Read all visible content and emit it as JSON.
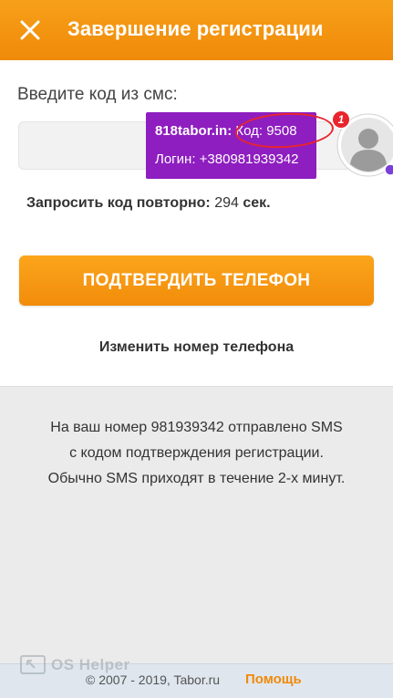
{
  "header": {
    "title": "Завершение регистрации",
    "close_icon": "close-icon"
  },
  "form": {
    "sms_label": "Введите код из смс:",
    "code_value": "",
    "resend_label": "Запросить код повторно:",
    "resend_seconds": "294",
    "resend_unit": "сек.",
    "confirm_label": "ПОДТВЕРДИТЬ ТЕЛЕФОН",
    "change_phone_label": "Изменить номер телефона"
  },
  "info": {
    "lines": [
      "На ваш номер 981939342 отправлено SMS",
      "с кодом подтверждения регистрации.",
      "Обычно SMS приходят в течение 2-х минут."
    ]
  },
  "notification": {
    "site": "818tabor.in:",
    "code_text": "Код: 9508",
    "login_text": "Логин: +380981939342",
    "badge": "1"
  },
  "footer": {
    "copyright": "© 2007 - 2019, Tabor.ru",
    "help_label": "Помощь",
    "watermark": "OS Helper"
  },
  "colors": {
    "accent": "#f08a0a",
    "notification": "#8e1ec0",
    "highlight": "#e8252c"
  }
}
